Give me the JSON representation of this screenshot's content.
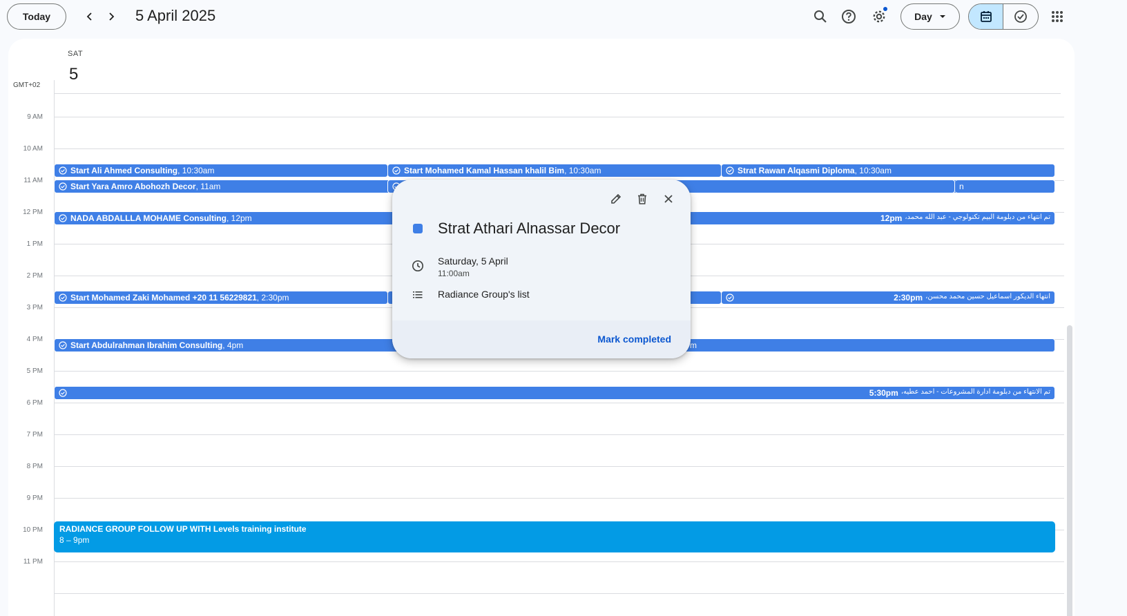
{
  "header": {
    "today_label": "Today",
    "date_title": "5 April 2025",
    "view_label": "Day",
    "icons": [
      "chevron-left-icon",
      "chevron-right-icon",
      "search-icon",
      "help-icon",
      "settings-icon",
      "calendar-icon",
      "tasks-icon",
      "apps-grid-icon"
    ]
  },
  "day": {
    "dow": "SAT",
    "num": "5",
    "timezone": "GMT+02"
  },
  "hours": [
    "9 AM",
    "10 AM",
    "11 AM",
    "12 PM",
    "1 PM",
    "2 PM",
    "3 PM",
    "4 PM",
    "5 PM",
    "6 PM",
    "7 PM",
    "8 PM",
    "9 PM",
    "10 PM",
    "11 PM"
  ],
  "events": {
    "e1": {
      "title": "Start Ali Ahmed Consulting",
      "time": "10:30am"
    },
    "e2": {
      "title": "Start Mohamed Kamal Hassan khalil Bim",
      "time": "10:30am"
    },
    "e3": {
      "title": "Strat Rawan Alqasmi Diploma",
      "time": "10:30am"
    },
    "e4": {
      "title": "Start Yara Amro Abohozh Decor",
      "time": "11am"
    },
    "e4b": {
      "tail": "n"
    },
    "e5": {
      "title": "NADA ABDALLLA MOHAME Consulting",
      "time": "12pm"
    },
    "e6": {
      "rtl": "تم انتهاء من دبلومة البيم تكنولوجي - عبد الله محمد،",
      "time": "12pm"
    },
    "e7": {
      "title": "Start Mohamed Zaki Mohamed +20 11 56229821",
      "time": "2:30pm"
    },
    "e8": {
      "rtl": "انتهاء الديكور اسماعيل حسين محمد محسن،",
      "time": "2:30pm"
    },
    "e9": {
      "title": "Start Abdulrahman Ibrahim Consulting",
      "time": "4pm"
    },
    "e9b": {
      "tail": "m"
    },
    "e10": {
      "rtl": "تم الانتهاء من دبلومة ادارة المشروعات - احمد عطيه،",
      "time": "5:30pm"
    },
    "e11": {
      "title": "RADIANCE GROUP FOLLOW UP WITH Levels training institute",
      "time": "8 – 9pm"
    }
  },
  "popup": {
    "title": "Strat Athari Alnassar Decor",
    "date": "Saturday, 5 April",
    "time": "11:00am",
    "list": "Radiance Group's list",
    "mark_label": "Mark completed",
    "color": "#3f7fe6"
  },
  "colors": {
    "task_blue": "#3f7fe6",
    "event_blue": "#039be5",
    "accent": "#0b57d0"
  }
}
